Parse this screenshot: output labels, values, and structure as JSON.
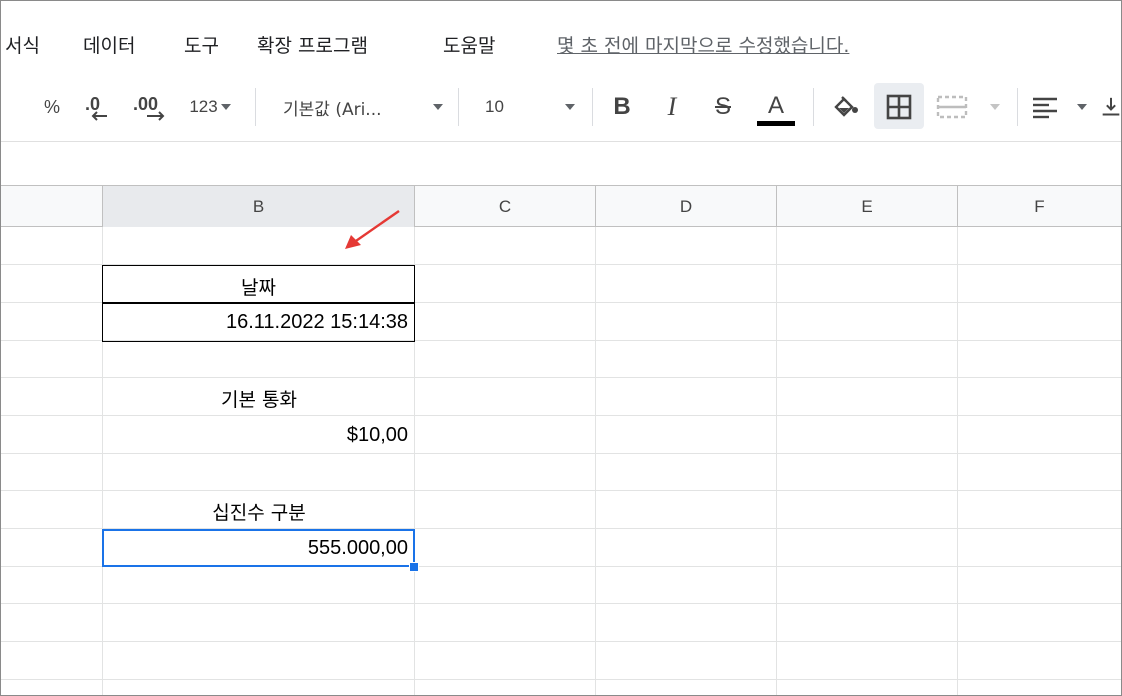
{
  "menu": {
    "items": [
      "서식",
      "데이터",
      "도구",
      "확장 프로그램",
      "도움말"
    ],
    "last_edit": "몇 초 전에 마지막으로 수정했습니다."
  },
  "toolbar": {
    "percent": "%",
    "decimal_decrease": ".0",
    "decimal_increase": ".00",
    "number_format": "123",
    "font_family": "기본값 (Ari...",
    "font_size": "10",
    "bold": "B",
    "italic": "I",
    "strikethrough": "S",
    "text_color": "A",
    "text_color_value": "#000000"
  },
  "columns": [
    "B",
    "C",
    "D",
    "E",
    "F"
  ],
  "active_column": "B",
  "cells": {
    "date_header": "날짜",
    "date_value": "16.11.2022 15:14:38",
    "currency_label": "기본 통화",
    "currency_value": "$10,00",
    "decimal_label": "십진수 구분",
    "decimal_value": "555.000,00"
  },
  "colors": {
    "selection": "#1a73e8",
    "annotation_arrow": "#e53935"
  }
}
